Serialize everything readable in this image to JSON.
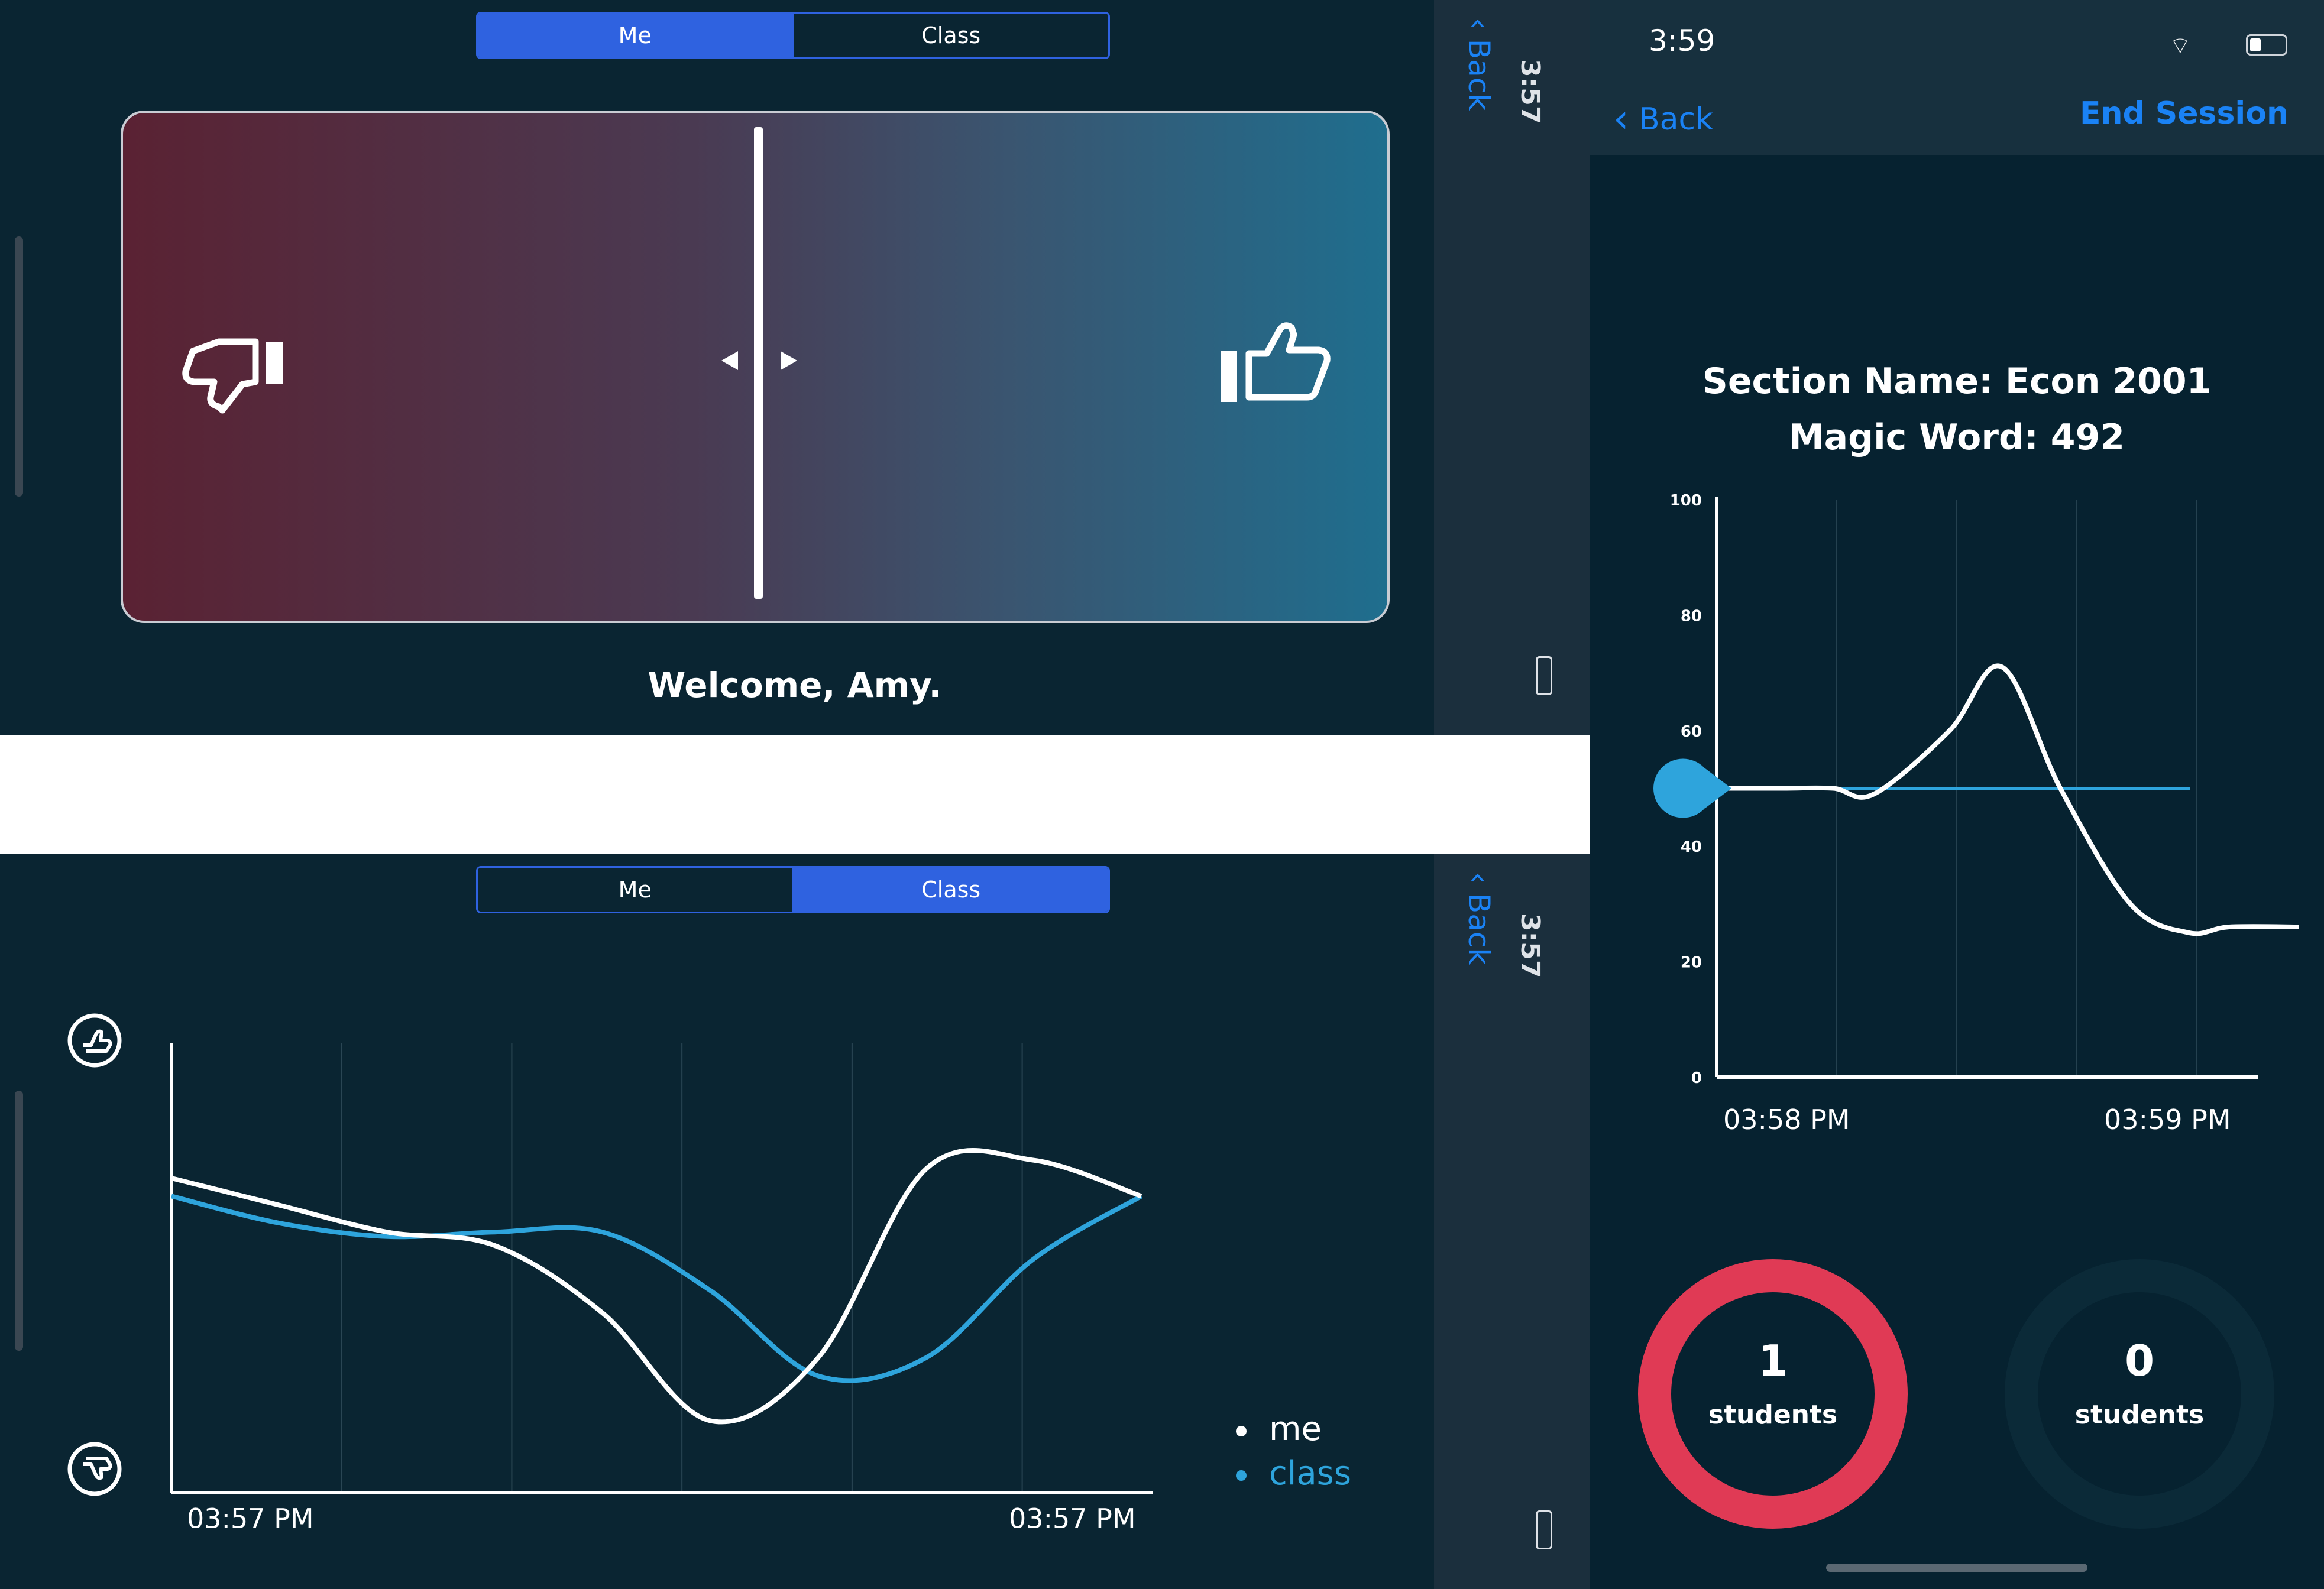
{
  "me_view": {
    "segment": {
      "me_label": "Me",
      "class_label": "Class",
      "selected": "Me"
    },
    "slider": {
      "level_percent": 50,
      "left_icon": "thumbs-down-icon",
      "right_icon": "thumbs-up-icon"
    },
    "welcome": "Welcome, Amy."
  },
  "class_view": {
    "segment": {
      "me_label": "Me",
      "class_label": "Class",
      "selected": "Class"
    },
    "chart_data": {
      "type": "line",
      "x_tick_labels": [
        "03:57 PM",
        "03:57 PM"
      ],
      "series": [
        {
          "name": "me",
          "color": "#ffffff",
          "values": [
            70,
            64,
            58,
            55,
            40,
            16,
            30,
            72,
            74,
            66
          ]
        },
        {
          "name": "class",
          "color": "#2ea4dc",
          "values": [
            66,
            60,
            57,
            58,
            58,
            45,
            26,
            30,
            52,
            66
          ]
        }
      ],
      "grid": true
    },
    "legend": {
      "me": "me",
      "class": "class"
    },
    "top_icon": "thumbs-up-circle-icon",
    "bottom_icon": "thumbs-down-circle-icon"
  },
  "side_strips": {
    "back_label": "Back",
    "time": "3:57"
  },
  "teacher": {
    "status_time": "3:59",
    "back_label": "Back",
    "end_session_label": "End Session",
    "section_name": "Section Name: Econ 2001",
    "magic_word": "Magic Word: 492",
    "chart_data": {
      "type": "line",
      "ylim": [
        0,
        100
      ],
      "y_ticks": [
        "100",
        "80",
        "60",
        "40",
        "20",
        "0"
      ],
      "x_tick_labels": [
        "03:58 PM",
        "03:59 PM"
      ],
      "series": [
        {
          "name": "",
          "color": "#ffffff",
          "values": [
            50,
            50,
            50,
            49,
            60,
            71,
            50,
            30,
            25,
            26,
            26
          ]
        },
        {
          "name": "",
          "color": "#2ea4dc",
          "values": [
            50,
            50
          ]
        }
      ],
      "marker_value": 50
    },
    "rings": [
      {
        "count": "1",
        "label": "students",
        "color": "#e03a55",
        "fill_fraction": 1
      },
      {
        "count": "0",
        "label": "students",
        "color": "#0b2a38",
        "fill_fraction": 0
      }
    ]
  }
}
